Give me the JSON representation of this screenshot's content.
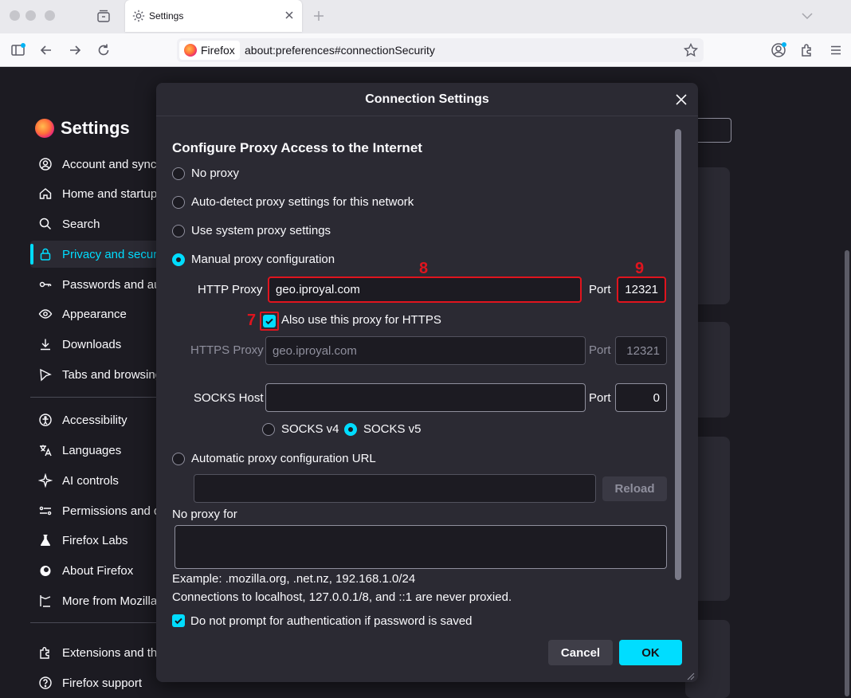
{
  "browser": {
    "tab_title": "Settings",
    "identity_label": "Firefox",
    "url": "about:preferences#connectionSecurity"
  },
  "settings": {
    "title": "Settings",
    "sidebar": [
      {
        "label": "Account and sync",
        "icon": "account-icon"
      },
      {
        "label": "Home and startup",
        "icon": "home-icon"
      },
      {
        "label": "Search",
        "icon": "search-icon"
      },
      {
        "label": "Privacy and security",
        "icon": "lock-icon",
        "active": true
      },
      {
        "label": "Passwords and autofill",
        "icon": "key-icon"
      },
      {
        "label": "Appearance",
        "icon": "eye-icon"
      },
      {
        "label": "Downloads",
        "icon": "download-icon"
      },
      {
        "label": "Tabs and browsing",
        "icon": "tab-icon"
      },
      {
        "label": "Accessibility",
        "icon": "accessibility-icon"
      },
      {
        "label": "Languages",
        "icon": "language-icon"
      },
      {
        "label": "AI controls",
        "icon": "sparkle-icon"
      },
      {
        "label": "Permissions and data",
        "icon": "permissions-icon"
      },
      {
        "label": "Firefox Labs",
        "icon": "flask-icon"
      },
      {
        "label": "About Firefox",
        "icon": "firefox-icon"
      },
      {
        "label": "More from Mozilla",
        "icon": "mozilla-icon"
      },
      {
        "label": "Extensions and themes",
        "icon": "extension-icon"
      },
      {
        "label": "Firefox support",
        "icon": "help-icon"
      }
    ]
  },
  "dialog": {
    "title": "Connection Settings",
    "section_title": "Configure Proxy Access to the Internet",
    "options": {
      "no_proxy": "No proxy",
      "auto_detect": "Auto-detect proxy settings for this network",
      "system": "Use system proxy settings",
      "manual": "Manual proxy configuration",
      "auto_url": "Automatic proxy configuration URL"
    },
    "selected_option": "manual",
    "http_proxy_label": "HTTP Proxy",
    "http_proxy_value": "geo.iproyal.com",
    "port_label": "Port",
    "http_port_value": "12321",
    "also_https_label": "Also use this proxy for HTTPS",
    "also_https_checked": true,
    "https_proxy_label": "HTTPS Proxy",
    "https_proxy_value": "geo.iproyal.com",
    "https_port_value": "12321",
    "socks_host_label": "SOCKS Host",
    "socks_host_value": "",
    "socks_port_value": "0",
    "socks_v4": "SOCKS v4",
    "socks_v5": "SOCKS v5",
    "socks_selected": "v5",
    "auto_url_value": "",
    "reload_label": "Reload",
    "no_proxy_for_label": "No proxy for",
    "no_proxy_for_value": "",
    "example_text": "Example: .mozilla.org, .net.nz, 192.168.1.0/24",
    "localhost_note": "Connections to localhost, 127.0.0.1/8, and ::1 are never proxied.",
    "no_prompt_label": "Do not prompt for authentication if password is saved",
    "no_prompt_checked": true,
    "cancel_label": "Cancel",
    "ok_label": "OK"
  },
  "annotations": {
    "marker_7": "7",
    "marker_8": "8",
    "marker_9": "9",
    "color": "#e0141e"
  },
  "colors": {
    "accent": "#00ddff",
    "dialog_bg": "#2b2a33",
    "page_bg": "#1c1b22"
  }
}
